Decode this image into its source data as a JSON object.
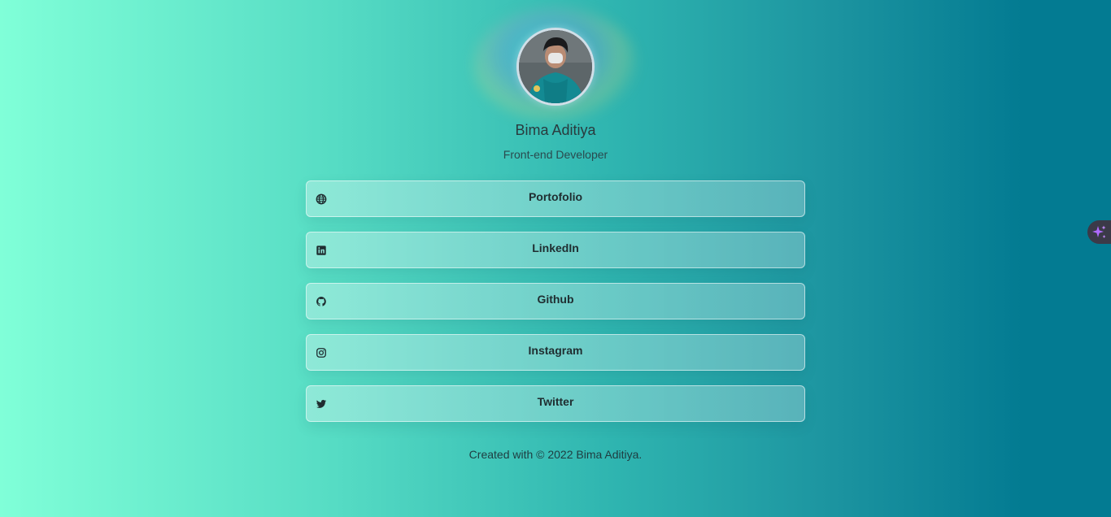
{
  "profile": {
    "name": "Bima Aditiya",
    "role": "Front-end Developer"
  },
  "links": [
    {
      "label": "Portofolio",
      "icon": "globe-icon"
    },
    {
      "label": "LinkedIn",
      "icon": "linkedin-icon"
    },
    {
      "label": "Github",
      "icon": "github-icon"
    },
    {
      "label": "Instagram",
      "icon": "instagram-icon"
    },
    {
      "label": "Twitter",
      "icon": "twitter-icon"
    }
  ],
  "footer": {
    "text": "Created with © 2022 Bima Aditiya."
  },
  "floating_button": {
    "icon": "sparkle-icon"
  },
  "colors": {
    "gradient_start": "#80ffd8",
    "gradient_end": "#037b92",
    "accent": "#b06aff"
  }
}
